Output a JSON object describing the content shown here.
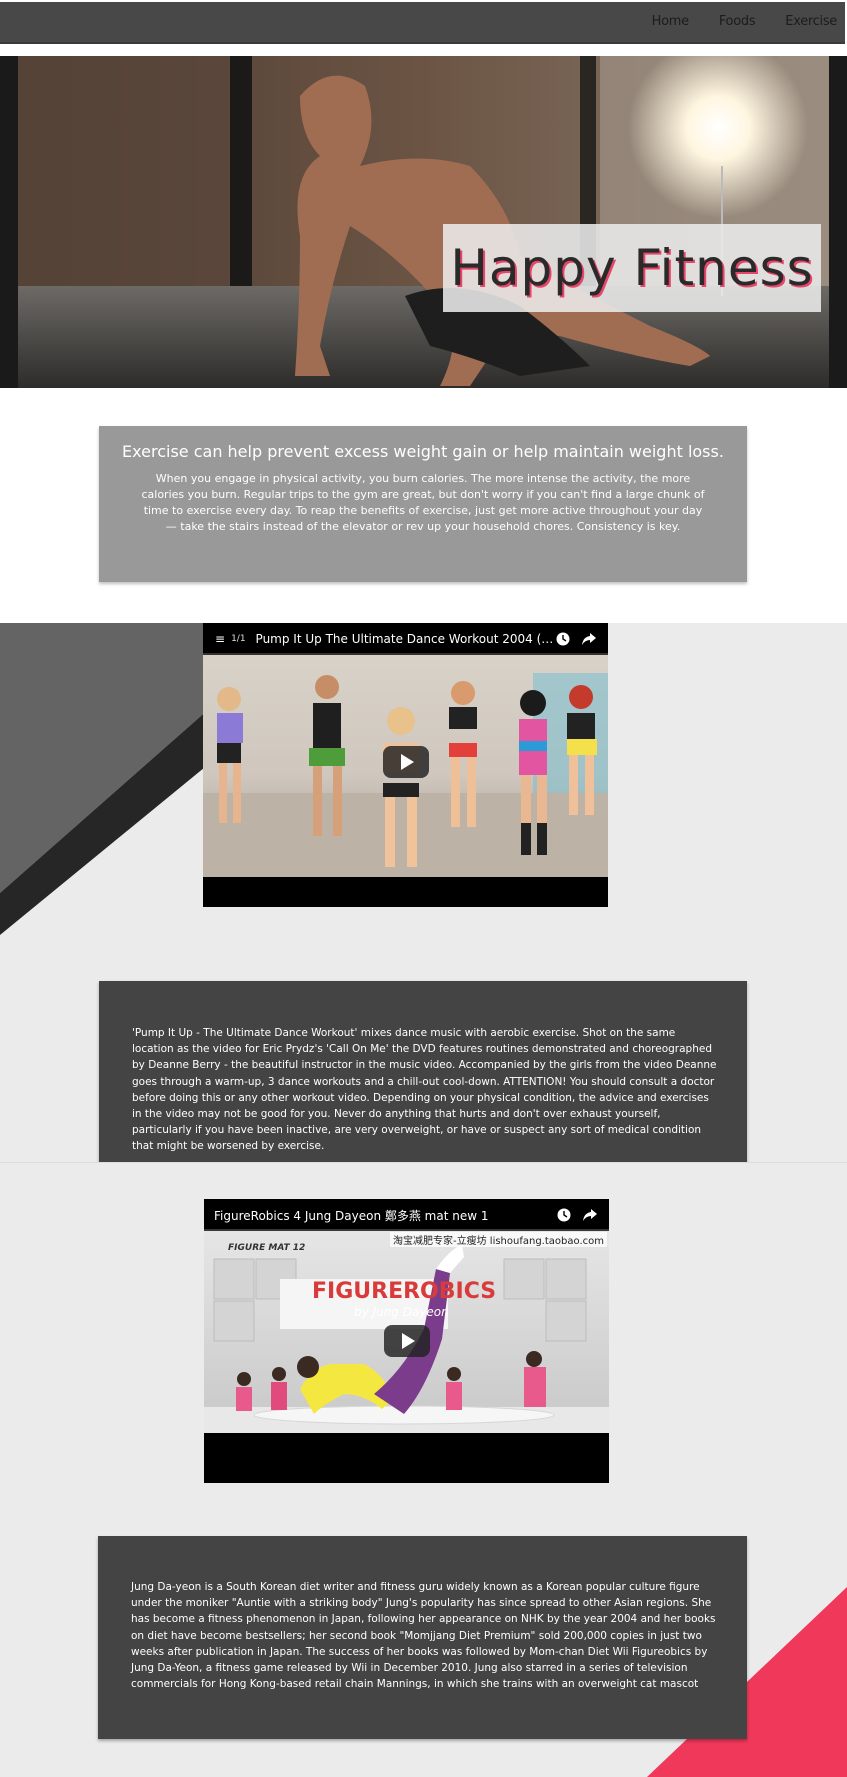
{
  "nav": {
    "items": [
      {
        "label": "Home"
      },
      {
        "label": "Foods"
      },
      {
        "label": "Exercise"
      }
    ]
  },
  "hero": {
    "title": "Happy Fitness",
    "image": "man-doing-push-up-photo"
  },
  "intro": {
    "heading": "Exercise can help prevent excess weight gain or help maintain weight loss.",
    "text": "When you engage in physical activity, you burn calories. The more intense the activity, the more calories you burn. Regular trips to the gym are great, but don't worry if you can't find a large chunk of time to exercise every day. To reap the benefits of exercise, just get more active throughout your day — take the stairs instead of the elevator or rev up your household chores. Consistency is key."
  },
  "video1": {
    "playlist_count": "1/1",
    "title": "Pump It Up The Ultimate Dance Workout 2004 (full vid...",
    "thumbnail": "dance-workout-group-photo"
  },
  "card1": {
    "text": "'Pump It Up - The Ultimate Dance Workout' mixes dance music with aerobic exercise. Shot on the same location as the video for Eric Prydz's 'Call On Me' the DVD features routines demonstrated and choreographed by Deanne Berry - the beautiful instructor in the music video. Accompanied by the girls from the video Deanne goes through a warm-up, 3 dance workouts and a chill-out cool-down. ATTENTION! You should consult a doctor before doing this or any other workout video. Depending on your physical condition, the advice and exercises in the video may not be good for you. Never do anything that hurts and don't over exhaust yourself, particularly if you have been inactive, are very overweight, or have or suspect any sort of medical condition that might be worsened by exercise."
  },
  "video2": {
    "title": "FigureRobics 4 Jung Dayeon 鄭多燕 mat new 1",
    "watermark": "淘宝减肥专家-立瘦坊  lishoufang.taobao.com",
    "mat_label": "FIGURE MAT 12",
    "brand": "FIGUREROBICS",
    "brand_sub": "by Jung Dayeon",
    "thumbnail": "figurerobics-mat-workout-photo"
  },
  "card2": {
    "text": "Jung Da-yeon is a South Korean diet writer and fitness guru widely known as a Korean popular culture figure under the moniker \"Auntie with a striking body\" Jung's popularity has since spread to other Asian regions. She has become a fitness phenomenon in Japan, following her appearance on NHK by the year 2004 and her books on diet have become bestsellers; her second book \"Momjjang Diet Premium\" sold 200,000 copies in just two weeks after publication in Japan. The success of her books was followed by Mom-chan Diet Wii Figureobics by Jung Da-Yeon, a fitness game released by Wii in December 2010. Jung also starred in a series of television commercials for Hong Kong-based retail chain Mannings, in which she trains with an overweight cat mascot"
  },
  "colors": {
    "navbar": "#484848",
    "accent": "#f0385a",
    "card_gray": "#999999",
    "card_dark": "#444444",
    "band": "#ebebeb"
  }
}
